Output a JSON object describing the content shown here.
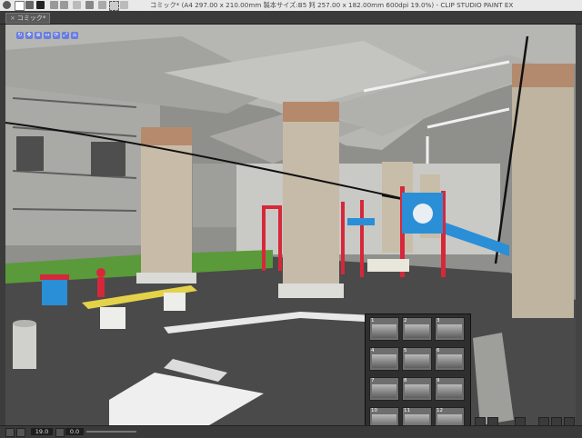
{
  "titlebar": {
    "title": "コミック* (A4 297.00 x 210.00mm 製本サイズ:B5 判 257.00 x 182.00mm 600dpi 19.0%) - CLIP STUDIO PAINT EX"
  },
  "tab": {
    "label": "コミック*"
  },
  "status": {
    "zoom": "19.0",
    "angle": "0.0"
  },
  "thumbnails": [
    {
      "n": "1"
    },
    {
      "n": "2"
    },
    {
      "n": "3"
    },
    {
      "n": "4"
    },
    {
      "n": "5"
    },
    {
      "n": "6"
    },
    {
      "n": "7"
    },
    {
      "n": "8"
    },
    {
      "n": "9"
    },
    {
      "n": "10"
    },
    {
      "n": "11"
    },
    {
      "n": "12"
    }
  ],
  "colors": {
    "accent": "#6a7de0",
    "concrete": "#9a9a96",
    "playground_red": "#d6283a",
    "playground_blue": "#2a8fd6",
    "bench_yellow": "#e4d24a"
  }
}
